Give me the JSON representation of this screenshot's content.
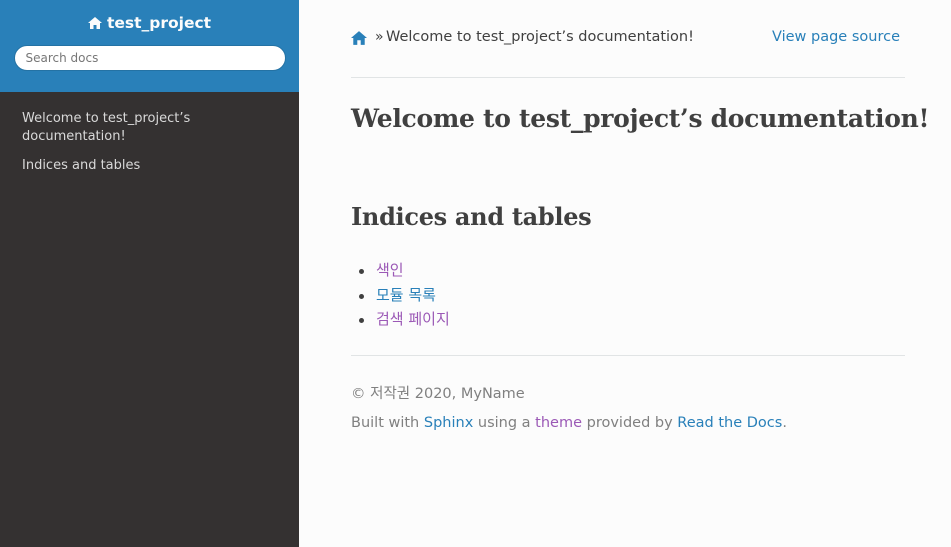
{
  "sidebar": {
    "project_name": "test_project",
    "search_placeholder": "Search docs",
    "items": [
      {
        "label": "Welcome to test_project’s documentation!"
      },
      {
        "label": "Indices and tables"
      }
    ]
  },
  "breadcrumbs": {
    "separator": "»",
    "current": "Welcome to test_project’s documentation!",
    "view_source": "View page source"
  },
  "content": {
    "title": "Welcome to test_project’s documentation!",
    "section_title": "Indices and tables",
    "links": [
      {
        "label": "색인"
      },
      {
        "label": "모듈 목록"
      },
      {
        "label": "검색 페이지"
      }
    ]
  },
  "footer": {
    "copyright": "© 저작권 2020, MyName",
    "built_prefix": "Built with ",
    "sphinx": "Sphinx",
    "using_a": " using a ",
    "theme": "theme",
    "provided_by": " provided by ",
    "rtd": "Read the Docs",
    "period": "."
  },
  "colors": {
    "sidebar_header": "#2980b9",
    "sidebar_bg": "#343131",
    "link": "#2980b9",
    "visited_link": "#9b59b6"
  },
  "icons": {
    "home": "home-icon"
  }
}
